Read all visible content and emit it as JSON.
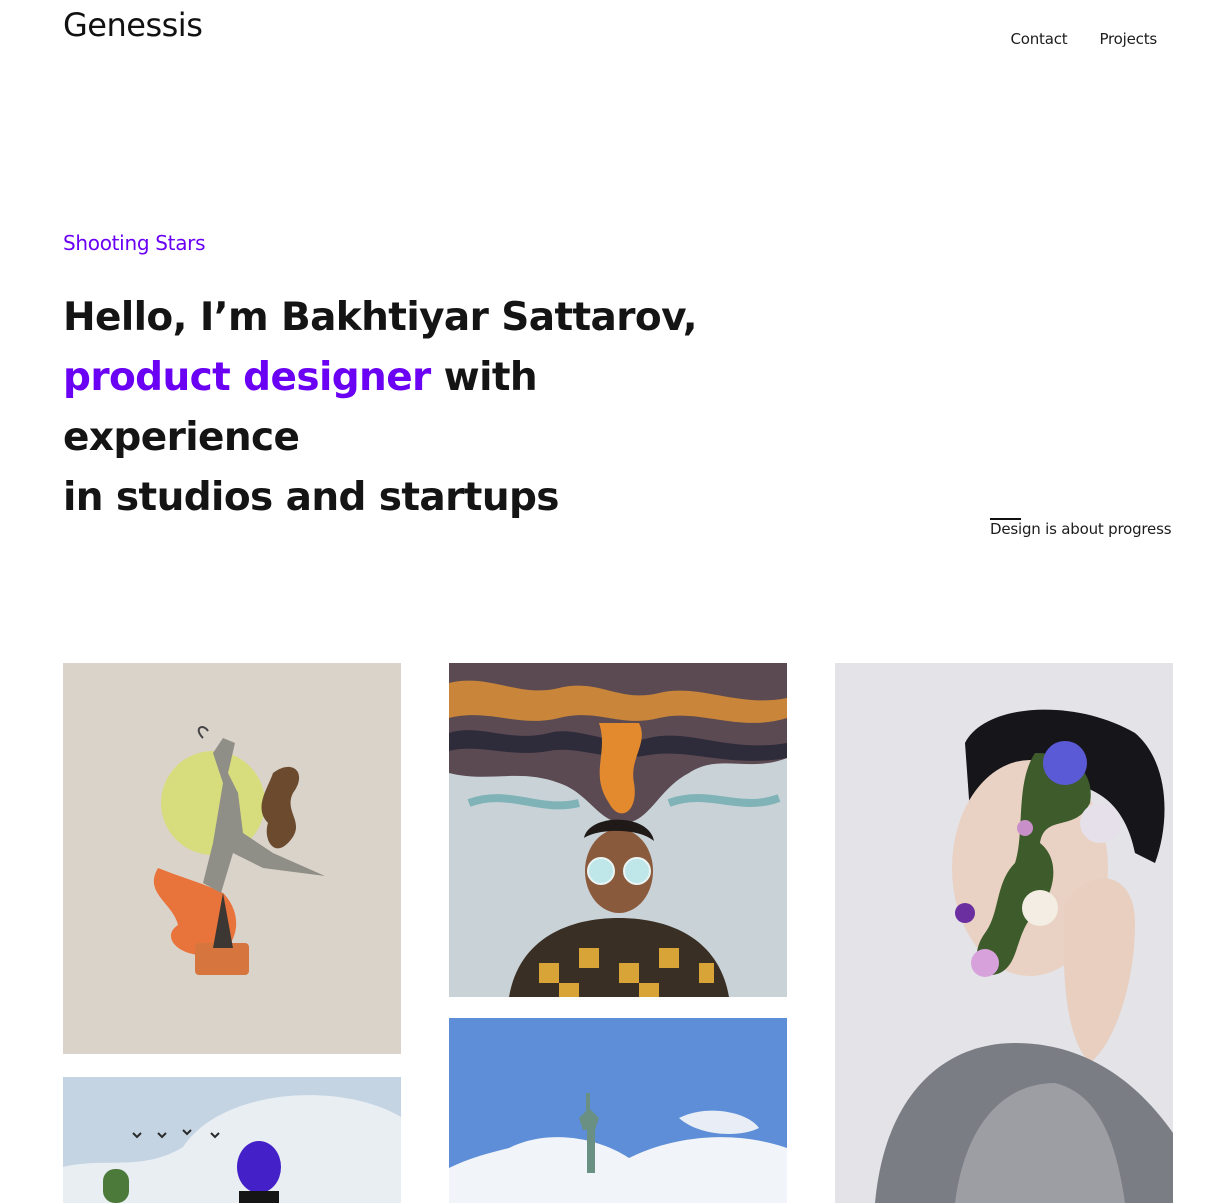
{
  "site": {
    "logo": "Genessis"
  },
  "nav": {
    "contact": "Contact",
    "projects": "Projects"
  },
  "hero": {
    "eyebrow": "Shooting Stars",
    "line1": "Hello, I’m Bakhtiyar Sattarov,",
    "accent": "product designer",
    "line2_rest": " with experience",
    "line3": "in studios and startups"
  },
  "tagline": "Design is about progress",
  "colors": {
    "accent": "#6a00f4",
    "text": "#141414",
    "background": "#ffffff"
  },
  "gallery": [
    {
      "name": "dancer-collage"
    },
    {
      "name": "smoke-head-portrait"
    },
    {
      "name": "flower-face-portrait"
    },
    {
      "name": "balloon-sky"
    },
    {
      "name": "statue-of-liberty"
    }
  ]
}
